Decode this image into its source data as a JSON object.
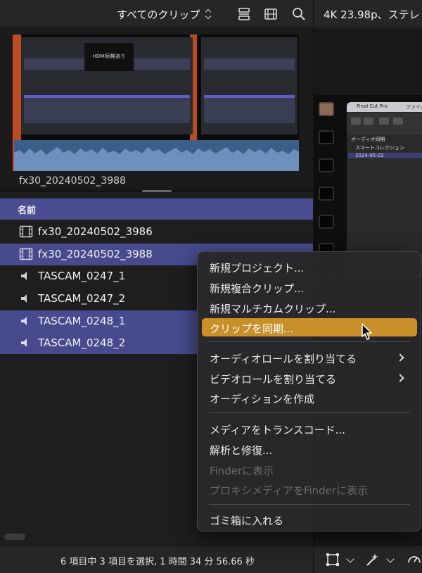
{
  "toolbar": {
    "filter_label": "すべてのクリップ",
    "format_label": "4K 23.98p、ステレ",
    "icons": [
      "chevron-updown-icon",
      "layout-icon",
      "filmstrip-icon",
      "search-icon"
    ]
  },
  "preview": {
    "clip_name": "fx30_20240502_3988",
    "frame_text": "HDMI同期あり"
  },
  "list": {
    "header": "名前",
    "rows": [
      {
        "name": "fx30_20240502_3986",
        "icon": "film-icon",
        "selected": false
      },
      {
        "name": "fx30_20240502_3988",
        "icon": "film-icon",
        "selected": true
      },
      {
        "name": "TASCAM_0247_1",
        "icon": "speaker-icon",
        "selected": false
      },
      {
        "name": "TASCAM_0247_2",
        "icon": "speaker-icon",
        "selected": false
      },
      {
        "name": "TASCAM_0248_1",
        "icon": "speaker-icon",
        "selected": true
      },
      {
        "name": "TASCAM_0248_2",
        "icon": "speaker-icon",
        "selected": true
      }
    ]
  },
  "viewer": {
    "menubar": {
      "app": "Final Cut Pro",
      "file": "ファイル"
    },
    "sidebar": [
      "オーディオ同期",
      "スマートコレクション",
      "2024-05-02"
    ]
  },
  "context_menu": {
    "items": [
      {
        "label": "新規プロジェクト..."
      },
      {
        "label": "新規複合クリップ..."
      },
      {
        "label": "新規マルチカムクリップ..."
      },
      {
        "label": "クリップを同期...",
        "highlighted": true
      },
      {
        "label": "オーディオロールを割り当てる",
        "submenu": true
      },
      {
        "label": "ビデオロールを割り当てる",
        "submenu": true
      },
      {
        "label": "オーディションを作成"
      },
      {
        "label": "メディアをトランスコード..."
      },
      {
        "label": "解析と修復..."
      },
      {
        "label": "Finderに表示",
        "disabled": true
      },
      {
        "label": "プロキシメディアをFinderに表示",
        "disabled": true
      },
      {
        "label": "ゴミ箱に入れる"
      }
    ]
  },
  "status": {
    "text": "6 項目中 3 項目を選択, 1 時間 34 分 56.66 秒"
  },
  "colors": {
    "selection": "#474b8e",
    "header": "#4a4d91",
    "menu_highlight": "#c9902a",
    "playhead": "#d9432f",
    "waveform": "#3d5e89"
  }
}
